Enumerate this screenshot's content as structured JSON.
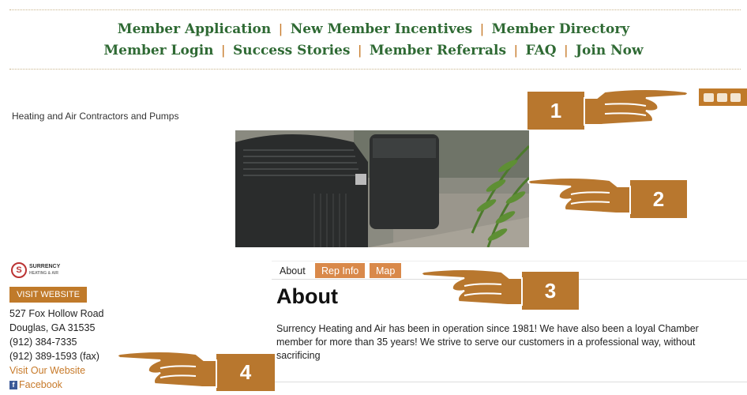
{
  "nav": {
    "row1": [
      "Member Application",
      "New Member Incentives",
      "Member Directory"
    ],
    "row2": [
      "Member Login",
      "Success Stories",
      "Member Referrals",
      "FAQ",
      "Join Now"
    ],
    "separator": "|"
  },
  "listing": {
    "category": "Heating and Air Contractors and Pumps"
  },
  "share_icons": [
    "print-icon",
    "email-icon",
    "share-icon"
  ],
  "logo": {
    "letter": "S",
    "name": "SURRENCY",
    "tagline": "HEATING & AIR"
  },
  "sidebar": {
    "visit_button": "VISIT WEBSITE",
    "address1": "527 Fox Hollow Road",
    "address2": "Douglas, GA 31535",
    "phone": "(912) 384-7335",
    "fax": "(912) 389-1593 (fax)",
    "website_link": "Visit Our Website",
    "facebook_link": "Facebook"
  },
  "tabs": [
    "About",
    "Rep Info",
    "Map"
  ],
  "about": {
    "heading": "About",
    "text": "Surrency Heating and Air has been in operation since 1981! We have also been a loyal Chamber member for more than 35 years! We strive to serve our customers in a professional way, without sacrificing"
  },
  "callouts": [
    "1",
    "2",
    "3",
    "4"
  ],
  "colors": {
    "nav_green": "#2f6a34",
    "accent_orange": "#c07a2a",
    "callout_brown": "#b8772e"
  }
}
